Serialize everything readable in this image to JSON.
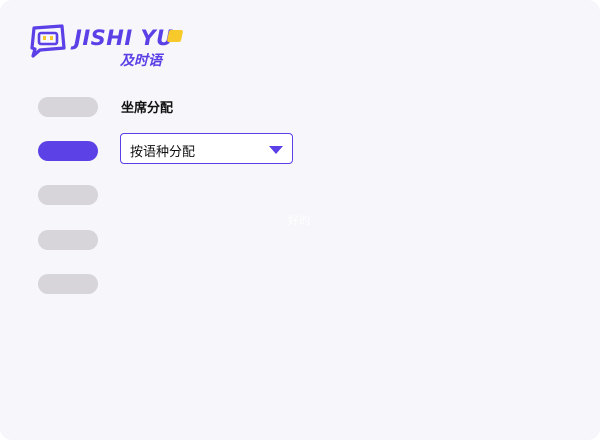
{
  "brand": {
    "name": "JISHI YU",
    "subtitle": "及时语",
    "color": "#5a40e6",
    "accent_color": "#f8c92a"
  },
  "nav": {
    "items": [
      {
        "state": "inactive"
      },
      {
        "state": "active"
      },
      {
        "state": "inactive"
      },
      {
        "state": "inactive"
      },
      {
        "state": "inactive"
      }
    ],
    "active_color": "#5b41e6",
    "inactive_color": "#d7d5da"
  },
  "section": {
    "title": "坐席分配",
    "select": {
      "value": "按语种分配",
      "icon": "chevron-down-icon"
    }
  },
  "watermark": {
    "text": "好的"
  }
}
